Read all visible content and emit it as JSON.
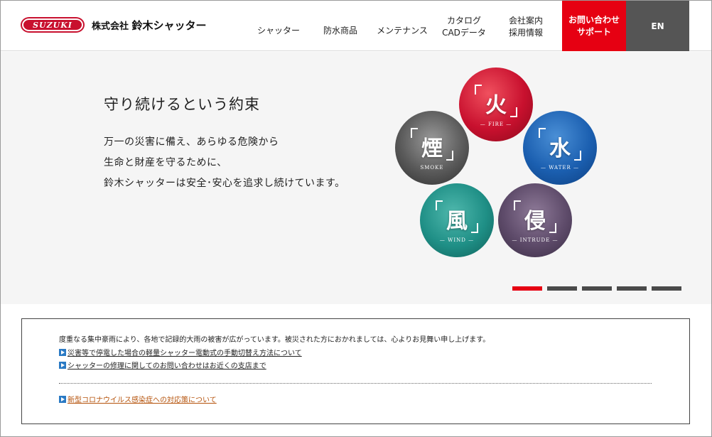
{
  "header": {
    "logo_badge": "SUZUKI",
    "logo_company_prefix": "株式会社",
    "logo_company_name": "鈴木シャッター",
    "nav": [
      {
        "label": "シャッター"
      },
      {
        "label": "防水商品"
      },
      {
        "label": "メンテナンス"
      },
      {
        "line1": "カタログ",
        "line2": "CADデータ"
      },
      {
        "line1": "会社案内",
        "line2": "採用情報"
      }
    ],
    "cta_line1": "お問い合わせ",
    "cta_line2": "サポート",
    "lang_label": "EN",
    "colors": {
      "brand_red": "#e60012",
      "lang_bg": "#555555"
    }
  },
  "hero": {
    "title": "守り続けるという約束",
    "lines": [
      "万一の災害に備え、あらゆる危険から",
      "生命と財産を守るために、",
      "鈴木シャッターは安全･安心を追求し続けています。"
    ],
    "circles": [
      {
        "kanji": "火",
        "caption": "— FIRE —"
      },
      {
        "kanji": "水",
        "caption": "— WATER —"
      },
      {
        "kanji": "煙",
        "caption": "SMOKE"
      },
      {
        "kanji": "風",
        "caption": "— WIND —"
      },
      {
        "kanji": "侵",
        "caption": "— INTRUDE —"
      }
    ],
    "carousel": {
      "total": 5,
      "active_index": 0
    }
  },
  "notice": {
    "text": "度重なる集中豪雨により、各地で記録的大雨の被害が広がっています。被災された方におかれましては、心よりお見舞い申し上げます。",
    "links": [
      {
        "label": "災害等で停電した場合の軽量シャッター電動式の手動切替え方法について"
      },
      {
        "label": "シャッターの修理に関してのお問い合わせはお近くの支店まで"
      },
      {
        "label": "新型コロナウイルス感染症への対応策について"
      }
    ]
  }
}
